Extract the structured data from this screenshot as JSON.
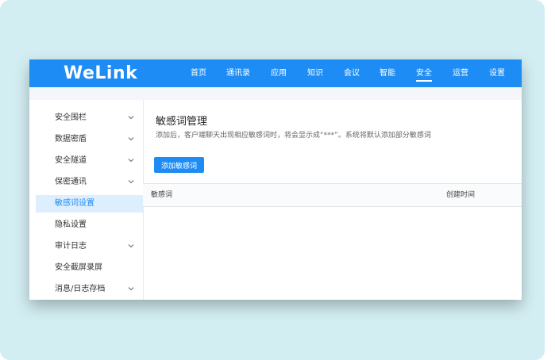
{
  "app": {
    "logo": "WeLink"
  },
  "nav": {
    "items": [
      {
        "label": "首页"
      },
      {
        "label": "通讯录"
      },
      {
        "label": "应用"
      },
      {
        "label": "知识"
      },
      {
        "label": "会议"
      },
      {
        "label": "智能"
      },
      {
        "label": "安全"
      },
      {
        "label": "运营"
      },
      {
        "label": "设置"
      }
    ],
    "active": "安全"
  },
  "sidebar": {
    "items": [
      {
        "label": "安全围栏",
        "expandable": true
      },
      {
        "label": "数据密盾",
        "expandable": true
      },
      {
        "label": "安全隧道",
        "expandable": true
      },
      {
        "label": "保密通讯",
        "expandable": true
      },
      {
        "label": "敏感词设置",
        "expandable": false,
        "selected": true
      },
      {
        "label": "隐私设置",
        "expandable": false
      },
      {
        "label": "审计日志",
        "expandable": true
      },
      {
        "label": "安全截屏录屏",
        "expandable": false
      },
      {
        "label": "消息/日志存档",
        "expandable": true
      }
    ]
  },
  "main": {
    "title": "敏感词管理",
    "description": "添加后，客户端聊天出现相应敏感词时，将会显示成“***”。系统将默认添加部分敏感词",
    "add_button": "添加敏感词",
    "table": {
      "columns": [
        "敏感词",
        "创建时间"
      ]
    }
  },
  "colors": {
    "brand": "#1e8cf5",
    "selected_bg": "#ddeefe",
    "frame_bg": "#d3eef2"
  }
}
